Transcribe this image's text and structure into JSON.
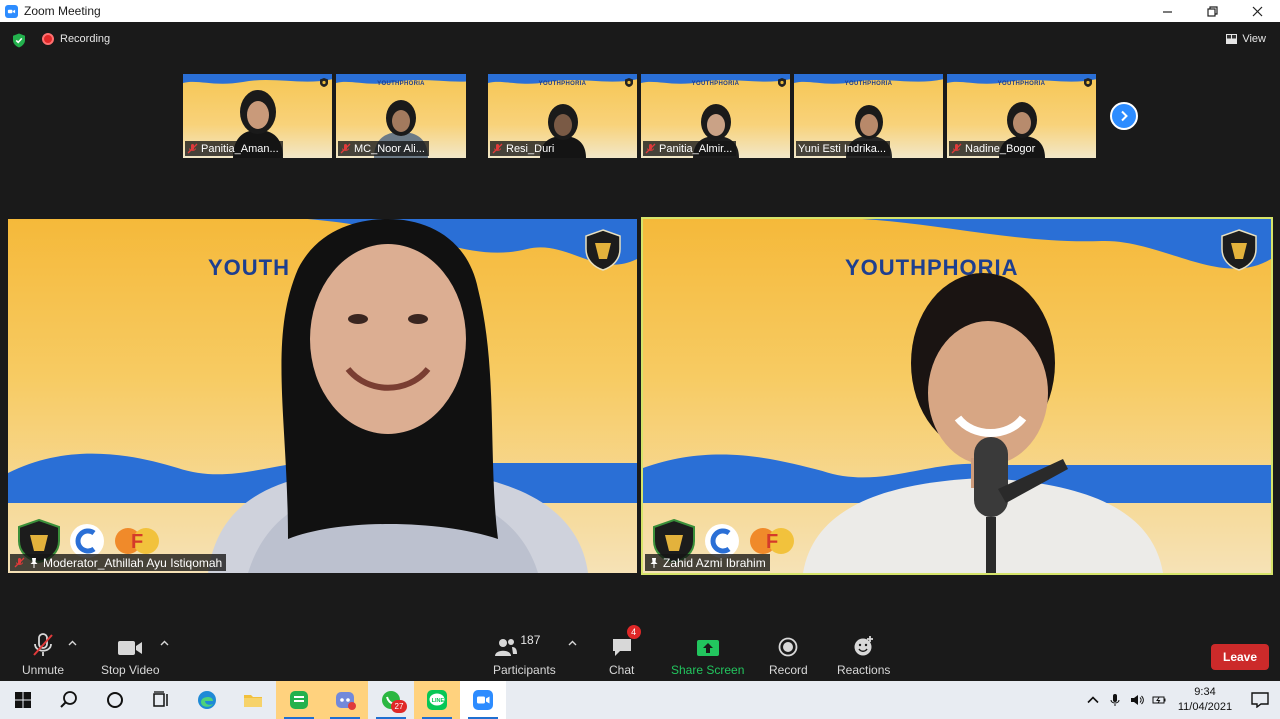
{
  "window": {
    "title": "Zoom Meeting"
  },
  "topbar": {
    "recording_label": "Recording",
    "view_label": "View"
  },
  "thumbnails": [
    {
      "name": "Panitia_Aman...",
      "brand": "",
      "muted": true
    },
    {
      "name": "MC_Noor Ali...",
      "brand": "YOUTHPHORIA",
      "muted": true
    },
    {
      "name": "Resi_Duri",
      "brand": "YOUTHPHORIA",
      "muted": true
    },
    {
      "name": "Panitia_Almir...",
      "brand": "YOUTHPHORIA",
      "muted": true
    },
    {
      "name": "Yuni Esti Indrika...",
      "brand": "YOUTHPHORIA",
      "muted": false
    },
    {
      "name": "Nadine_Bogor",
      "brand": "YOUTHPHORIA",
      "muted": true
    }
  ],
  "tiles": [
    {
      "name": "Moderator_Athillah Ayu Istiqomah",
      "brand": "YOUTH",
      "muted": true
    },
    {
      "name": "Zahid Azmi Ibrahim",
      "brand": "YOUTHPHORIA",
      "muted": false
    }
  ],
  "toolbar": {
    "unmute_label": "Unmute",
    "stop_video_label": "Stop Video",
    "participants_label": "Participants",
    "participants_count": "187",
    "chat_label": "Chat",
    "chat_badge": "4",
    "share_label": "Share Screen",
    "record_label": "Record",
    "reactions_label": "Reactions",
    "leave_label": "Leave"
  },
  "taskbar": {
    "whatsapp_badge": "27",
    "time": "9:34",
    "date": "11/04/2021"
  },
  "colors": {
    "zoom_blue": "#2D8CFF",
    "leave_red": "#cc2a2a",
    "share_green": "#22c55e",
    "active_speaker_border": "#d6e46a",
    "brand_blue": "#1e3f8f"
  }
}
